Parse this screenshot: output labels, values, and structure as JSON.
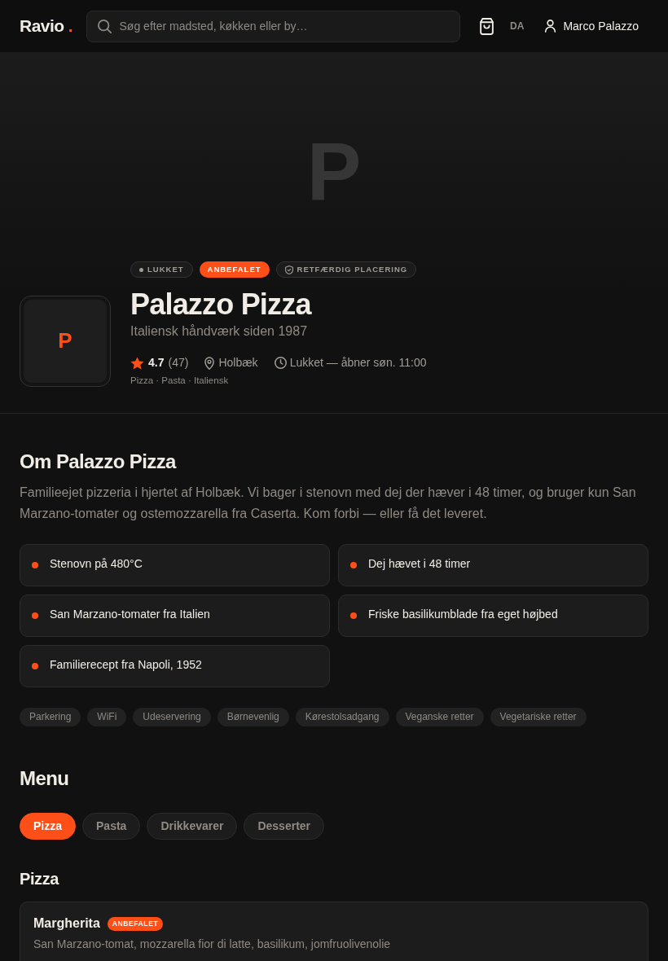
{
  "header": {
    "logo": "Ravio",
    "logo_dot": ".",
    "search": {
      "placeholder": "Søg efter madsted, køkken eller by…"
    },
    "language": "DA",
    "user_name": "Marco Palazzo"
  },
  "hero": {
    "cover_letter": "P",
    "badges": [
      {
        "kind": "status",
        "label": "LUKKET"
      },
      {
        "kind": "featured",
        "label": "ANBEFALET"
      },
      {
        "kind": "verified",
        "label": "RETFÆRDIG PLACERING"
      }
    ],
    "logo_letter": "P",
    "name": "Palazzo Pizza",
    "tagline": "Italiensk håndværk siden 1987",
    "rating": "4.7",
    "review_count": "(47)",
    "location": "Holbæk",
    "hours": "Lukket — åbner søn. 11:00",
    "cuisines": "Pizza · Pasta · Italiensk"
  },
  "about": {
    "title": "Om Palazzo Pizza",
    "description": "Familieejet pizzeria i hjertet af Holbæk. Vi bager i stenovn med dej der hæver i 48 timer, og bruger kun San Marzano-tomater og ostemozzarella fra Caserta. Kom forbi — eller få det leveret.",
    "highlights": [
      "Stenovn på 480°C",
      "Dej hævet i 48 timer",
      "San Marzano-tomater fra Italien",
      "Friske basilikumblade fra eget højbed",
      "Familierecept fra Napoli, 1952"
    ],
    "amenities": [
      "Parkering",
      "WiFi",
      "Udeservering",
      "Børnevenlig",
      "Kørestolsadgang",
      "Veganske retter",
      "Vegetariske retter"
    ]
  },
  "menu": {
    "title": "Menu",
    "tabs": [
      {
        "label": "Pizza",
        "selected": true
      },
      {
        "label": "Pasta",
        "selected": false
      },
      {
        "label": "Drikkevarer",
        "selected": false
      },
      {
        "label": "Desserter",
        "selected": false
      }
    ],
    "sections": [
      {
        "title": "Pizza",
        "items": [
          {
            "name": "Margherita",
            "badge": "ANBEFALET",
            "description": "San Marzano-tomat, mozzarella fior di latte, basilikum, jomfruolivenolie"
          }
        ]
      }
    ]
  }
}
